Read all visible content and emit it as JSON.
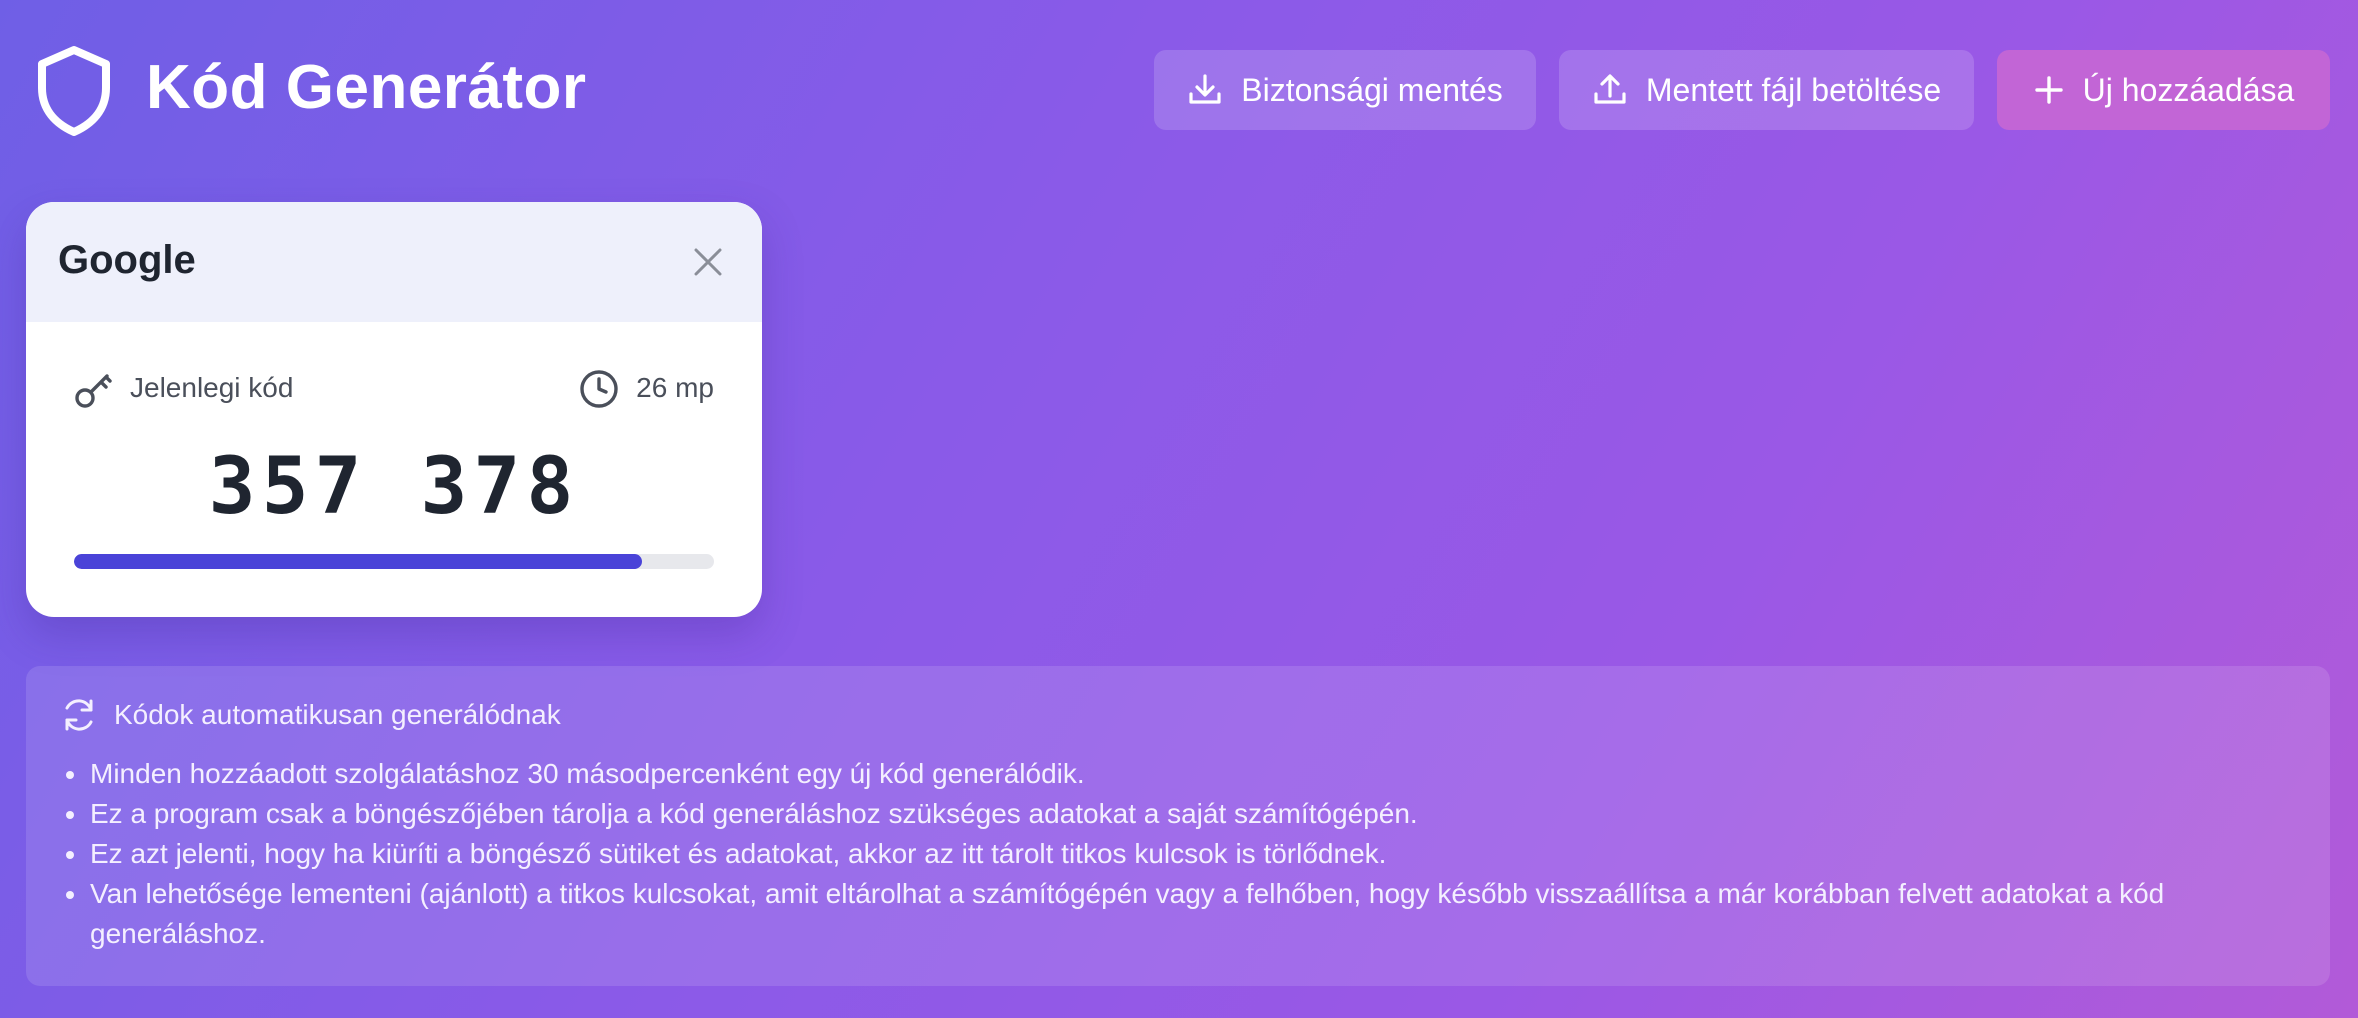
{
  "app": {
    "title": "Kód Generátor",
    "logo_icon": "shield-icon"
  },
  "toolbar": {
    "backup_label": "Biztonsági mentés",
    "backup_icon": "download-icon",
    "load_label": "Mentett fájl betöltése",
    "load_icon": "upload-icon",
    "add_label": "Új hozzáadása",
    "add_icon": "plus-icon"
  },
  "card": {
    "service_name": "Google",
    "code_label": "Jelenlegi kód",
    "code": "357 378",
    "time_left": "26 mp",
    "progress": 0.887,
    "progress_color": "#4a43d8"
  },
  "info": {
    "title": "Kódok automatikusan generálódnak",
    "items": [
      "Minden hozzáadott szolgálatáshoz 30 másodpercenként egy új kód generálódik.",
      "Ez a program csak a böngészőjében tárolja a kód generáláshoz szükséges adatokat a saját számítógépén.",
      "Ez azt jelenti, hogy ha kiüríti a böngésző sütiket és adatokat, akkor az itt tárolt titkos kulcsok is törlődnek.",
      "Van lehetősége lementeni (ajánlott) a titkos kulcsokat, amit eltárolhat a számítógépén vagy a felhőben, hogy később visszaállítsa a már korábban felvett adatokat a kód generáláshoz."
    ]
  },
  "colors": {
    "background_start": "#6f5fe6",
    "background_end": "#b25ad8",
    "add_button": "#c265d6"
  }
}
